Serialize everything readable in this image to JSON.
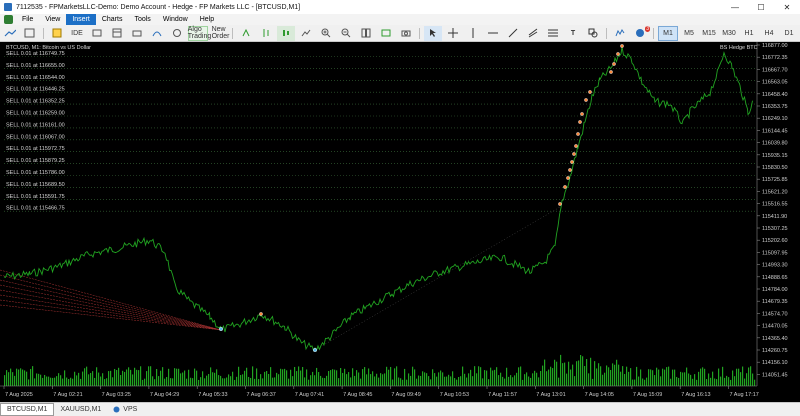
{
  "window": {
    "title": "7112535 - FPMarketsLLC-Demo: Demo Account - Hedge - FP Markets LLC - [BTCUSD,M1]",
    "minimize": "—",
    "maximize": "☐",
    "close": "✕"
  },
  "menu": {
    "items": [
      "File",
      "View",
      "Insert",
      "Charts",
      "Tools",
      "Window",
      "Help"
    ],
    "active": "Insert"
  },
  "toolbar": {
    "ide_label": "IDE",
    "algo_label": "Algo Trading",
    "new_order_label": "New Order",
    "notification_count": "3",
    "timeframes": [
      "M1",
      "M5",
      "M15",
      "M30",
      "H1",
      "H4",
      "D1",
      "W1",
      "MN"
    ],
    "selected_timeframe": "M1",
    "accent_green": "#2e9b2e",
    "accent_blue": "#1c6fc6"
  },
  "chart": {
    "symbol_header": "BTCUSD, M1: Bitcoin vs US Dollar",
    "ea_label": "BS Hedge BTC",
    "background": "#000000",
    "price_color": "#21a321",
    "volume_color": "#21a321",
    "order_labels": [
      "SELL 0.01 at 116749.75",
      "SELL 0.01 at 116655.00",
      "SELL 0.01 at 116544.00",
      "SELL 0.01 at 116446.25",
      "SELL 0.01 at 116352.25",
      "SELL 0.01 at 116259.00",
      "SELL 0.01 at 116161.00",
      "SELL 0.01 at 116067.00",
      "SELL 0.01 at 115972.75",
      "SELL 0.01 at 115879.25",
      "SELL 0.01 at 115786.00",
      "SELL 0.01 at 115689.50",
      "SELL 0.01 at 115591.75",
      "SELL 0.01 at 115466.75"
    ],
    "price_axis": [
      "116877.00",
      "116772.35",
      "116667.70",
      "116563.05",
      "116458.40",
      "116353.75",
      "116249.10",
      "116144.45",
      "116039.80",
      "115935.15",
      "115830.50",
      "115725.85",
      "115621.20",
      "115516.55",
      "115411.90",
      "115307.25",
      "115202.60",
      "115097.95",
      "114993.30",
      "114888.65",
      "114784.00",
      "114679.35",
      "114574.70",
      "114470.05",
      "114365.40",
      "114260.75",
      "114156.10",
      "114051.45"
    ],
    "time_axis": [
      "7 Aug 2025",
      "7 Aug 02:21",
      "7 Aug 03:25",
      "7 Aug 04:29",
      "7 Aug 05:33",
      "7 Aug 06:37",
      "7 Aug 07:41",
      "7 Aug 08:45",
      "7 Aug 09:49",
      "7 Aug 10:53",
      "7 Aug 11:57",
      "7 Aug 13:01",
      "7 Aug 14:05",
      "7 Aug 15:09",
      "7 Aug 16:13",
      "7 Aug 17:17"
    ]
  },
  "bottom_tabs": {
    "items": [
      "BTCUSD,M1",
      "XAUUSD,M1",
      "VPS"
    ],
    "active": "BTCUSD,M1"
  }
}
